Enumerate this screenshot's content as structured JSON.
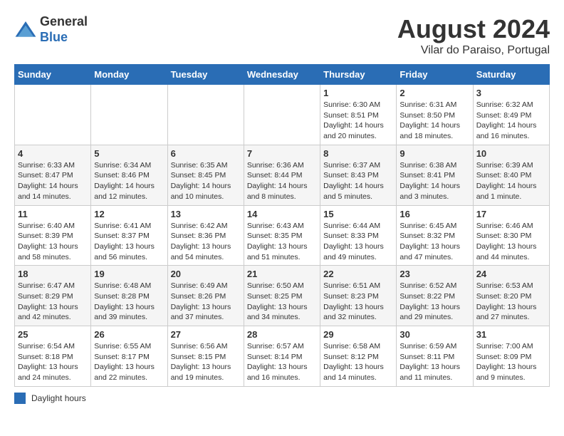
{
  "header": {
    "logo_general": "General",
    "logo_blue": "Blue",
    "month_title": "August 2024",
    "subtitle": "Vilar do Paraiso, Portugal"
  },
  "weekdays": [
    "Sunday",
    "Monday",
    "Tuesday",
    "Wednesday",
    "Thursday",
    "Friday",
    "Saturday"
  ],
  "weeks": [
    [
      {
        "day": "",
        "info": ""
      },
      {
        "day": "",
        "info": ""
      },
      {
        "day": "",
        "info": ""
      },
      {
        "day": "",
        "info": ""
      },
      {
        "day": "1",
        "info": "Sunrise: 6:30 AM\nSunset: 8:51 PM\nDaylight: 14 hours and 20 minutes."
      },
      {
        "day": "2",
        "info": "Sunrise: 6:31 AM\nSunset: 8:50 PM\nDaylight: 14 hours and 18 minutes."
      },
      {
        "day": "3",
        "info": "Sunrise: 6:32 AM\nSunset: 8:49 PM\nDaylight: 14 hours and 16 minutes."
      }
    ],
    [
      {
        "day": "4",
        "info": "Sunrise: 6:33 AM\nSunset: 8:47 PM\nDaylight: 14 hours and 14 minutes."
      },
      {
        "day": "5",
        "info": "Sunrise: 6:34 AM\nSunset: 8:46 PM\nDaylight: 14 hours and 12 minutes."
      },
      {
        "day": "6",
        "info": "Sunrise: 6:35 AM\nSunset: 8:45 PM\nDaylight: 14 hours and 10 minutes."
      },
      {
        "day": "7",
        "info": "Sunrise: 6:36 AM\nSunset: 8:44 PM\nDaylight: 14 hours and 8 minutes."
      },
      {
        "day": "8",
        "info": "Sunrise: 6:37 AM\nSunset: 8:43 PM\nDaylight: 14 hours and 5 minutes."
      },
      {
        "day": "9",
        "info": "Sunrise: 6:38 AM\nSunset: 8:41 PM\nDaylight: 14 hours and 3 minutes."
      },
      {
        "day": "10",
        "info": "Sunrise: 6:39 AM\nSunset: 8:40 PM\nDaylight: 14 hours and 1 minute."
      }
    ],
    [
      {
        "day": "11",
        "info": "Sunrise: 6:40 AM\nSunset: 8:39 PM\nDaylight: 13 hours and 58 minutes."
      },
      {
        "day": "12",
        "info": "Sunrise: 6:41 AM\nSunset: 8:37 PM\nDaylight: 13 hours and 56 minutes."
      },
      {
        "day": "13",
        "info": "Sunrise: 6:42 AM\nSunset: 8:36 PM\nDaylight: 13 hours and 54 minutes."
      },
      {
        "day": "14",
        "info": "Sunrise: 6:43 AM\nSunset: 8:35 PM\nDaylight: 13 hours and 51 minutes."
      },
      {
        "day": "15",
        "info": "Sunrise: 6:44 AM\nSunset: 8:33 PM\nDaylight: 13 hours and 49 minutes."
      },
      {
        "day": "16",
        "info": "Sunrise: 6:45 AM\nSunset: 8:32 PM\nDaylight: 13 hours and 47 minutes."
      },
      {
        "day": "17",
        "info": "Sunrise: 6:46 AM\nSunset: 8:30 PM\nDaylight: 13 hours and 44 minutes."
      }
    ],
    [
      {
        "day": "18",
        "info": "Sunrise: 6:47 AM\nSunset: 8:29 PM\nDaylight: 13 hours and 42 minutes."
      },
      {
        "day": "19",
        "info": "Sunrise: 6:48 AM\nSunset: 8:28 PM\nDaylight: 13 hours and 39 minutes."
      },
      {
        "day": "20",
        "info": "Sunrise: 6:49 AM\nSunset: 8:26 PM\nDaylight: 13 hours and 37 minutes."
      },
      {
        "day": "21",
        "info": "Sunrise: 6:50 AM\nSunset: 8:25 PM\nDaylight: 13 hours and 34 minutes."
      },
      {
        "day": "22",
        "info": "Sunrise: 6:51 AM\nSunset: 8:23 PM\nDaylight: 13 hours and 32 minutes."
      },
      {
        "day": "23",
        "info": "Sunrise: 6:52 AM\nSunset: 8:22 PM\nDaylight: 13 hours and 29 minutes."
      },
      {
        "day": "24",
        "info": "Sunrise: 6:53 AM\nSunset: 8:20 PM\nDaylight: 13 hours and 27 minutes."
      }
    ],
    [
      {
        "day": "25",
        "info": "Sunrise: 6:54 AM\nSunset: 8:18 PM\nDaylight: 13 hours and 24 minutes."
      },
      {
        "day": "26",
        "info": "Sunrise: 6:55 AM\nSunset: 8:17 PM\nDaylight: 13 hours and 22 minutes."
      },
      {
        "day": "27",
        "info": "Sunrise: 6:56 AM\nSunset: 8:15 PM\nDaylight: 13 hours and 19 minutes."
      },
      {
        "day": "28",
        "info": "Sunrise: 6:57 AM\nSunset: 8:14 PM\nDaylight: 13 hours and 16 minutes."
      },
      {
        "day": "29",
        "info": "Sunrise: 6:58 AM\nSunset: 8:12 PM\nDaylight: 13 hours and 14 minutes."
      },
      {
        "day": "30",
        "info": "Sunrise: 6:59 AM\nSunset: 8:11 PM\nDaylight: 13 hours and 11 minutes."
      },
      {
        "day": "31",
        "info": "Sunrise: 7:00 AM\nSunset: 8:09 PM\nDaylight: 13 hours and 9 minutes."
      }
    ]
  ],
  "legend": {
    "box_label": "Daylight hours"
  }
}
